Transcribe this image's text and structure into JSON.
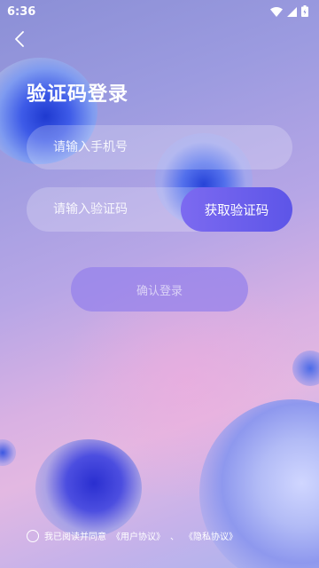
{
  "status": {
    "time": "6:36",
    "icons": [
      "wifi-icon",
      "signal-icon",
      "battery-icon"
    ]
  },
  "nav": {
    "back_icon": "chevron-left-icon"
  },
  "page": {
    "title": "验证码登录"
  },
  "form": {
    "phone_placeholder": "请输入手机号",
    "code_placeholder": "请输入验证码",
    "get_code_label": "获取验证码",
    "submit_label": "确认登录"
  },
  "agreement": {
    "prefix": "我已阅读并同意",
    "user_agreement": "《用户协议》",
    "separator": "、",
    "privacy_policy": "《隐私协议》"
  },
  "colors": {
    "accent": "#6a5ff0",
    "text": "#ffffff"
  }
}
